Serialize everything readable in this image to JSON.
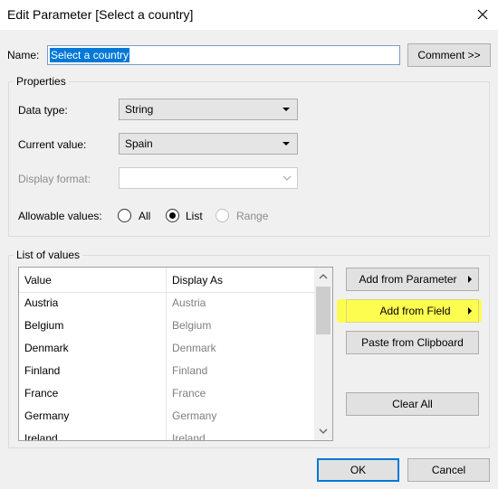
{
  "window": {
    "title": "Edit Parameter [Select a country]"
  },
  "name": {
    "label": "Name:",
    "value": "Select a country"
  },
  "comment_button": "Comment >>",
  "properties": {
    "legend": "Properties",
    "data_type": {
      "label": "Data type:",
      "value": "String"
    },
    "current_value": {
      "label": "Current value:",
      "value": "Spain"
    },
    "display_format": {
      "label": "Display format:",
      "value": ""
    },
    "allowable": {
      "label": "Allowable values:",
      "options": [
        "All",
        "List",
        "Range"
      ],
      "selected": "List"
    }
  },
  "list_of_values": {
    "legend": "List of values",
    "columns": [
      "Value",
      "Display As"
    ],
    "rows": [
      {
        "value": "Austria",
        "display": "Austria"
      },
      {
        "value": "Belgium",
        "display": "Belgium"
      },
      {
        "value": "Denmark",
        "display": "Denmark"
      },
      {
        "value": "Finland",
        "display": "Finland"
      },
      {
        "value": "France",
        "display": "France"
      },
      {
        "value": "Germany",
        "display": "Germany"
      },
      {
        "value": "Ireland",
        "display": "Ireland"
      }
    ]
  },
  "side_buttons": {
    "add_from_parameter": "Add from Parameter",
    "add_from_field": "Add from Field",
    "paste_from_clipboard": "Paste from Clipboard",
    "clear_all": "Clear All"
  },
  "footer": {
    "ok": "OK",
    "cancel": "Cancel"
  },
  "colors": {
    "selection": "#0078d7",
    "highlight": "#ffff33",
    "dialog_bg": "#f0f0f0"
  }
}
